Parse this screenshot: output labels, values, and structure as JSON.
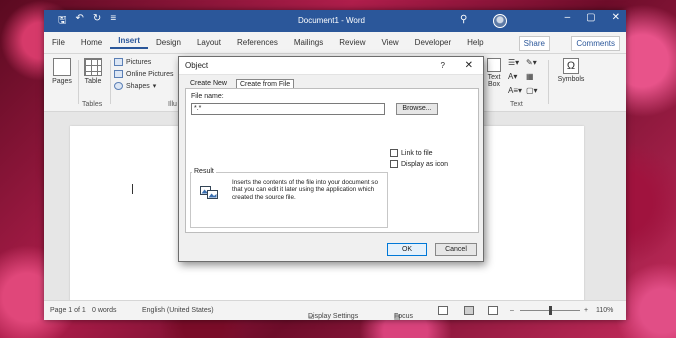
{
  "titlebar": {
    "doc_title": "Document1 - Word",
    "qat_icons": [
      "save-icon",
      "undo-icon",
      "redo-icon",
      "customize-icon"
    ]
  },
  "tabs": [
    {
      "label": "File"
    },
    {
      "label": "Home"
    },
    {
      "label": "Insert",
      "active": true
    },
    {
      "label": "Design"
    },
    {
      "label": "Layout"
    },
    {
      "label": "References"
    },
    {
      "label": "Mailings"
    },
    {
      "label": "Review"
    },
    {
      "label": "View"
    },
    {
      "label": "Developer"
    },
    {
      "label": "Help"
    }
  ],
  "share_label": "Share",
  "comments_label": "Comments",
  "ribbon": {
    "pages": "Pages",
    "table": "Table",
    "tables_group": "Tables",
    "illustrations_group": "Illu",
    "pictures": "Pictures",
    "online_pictures": "Online Pictures",
    "shapes": "Shapes",
    "text_box": "Text Box",
    "text_group": "Text",
    "symbols": "Symbols"
  },
  "dialog": {
    "title": "Object",
    "help": "?",
    "close": "✕",
    "tab_create_new": "Create New",
    "tab_create_from_file": "Create from File",
    "file_name_label": "File name:",
    "file_name_value": "*.*",
    "browse": "Browse...",
    "link_to_file": "Link to file",
    "display_as_icon": "Display as icon",
    "result_label": "Result",
    "result_text": "Inserts the contents of the file into your document so that you can edit it later using the application which created the source file.",
    "ok": "OK",
    "cancel": "Cancel"
  },
  "statusbar": {
    "page": "Page 1 of 1",
    "words": "0 words",
    "language": "English (United States)",
    "display_settings": "Display Settings",
    "focus": "Focus",
    "zoom": "110%",
    "zoom_minus": "–",
    "zoom_plus": "+"
  }
}
